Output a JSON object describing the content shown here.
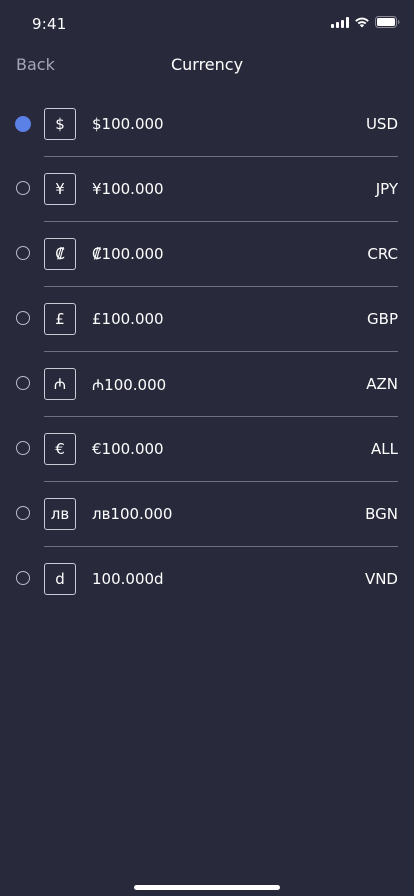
{
  "status_bar": {
    "time": "9:41"
  },
  "nav": {
    "back_label": "Back",
    "title": "Currency"
  },
  "currencies": [
    {
      "symbol": "$",
      "amount": "$100.000",
      "code": "USD",
      "selected": true
    },
    {
      "symbol": "¥",
      "amount": "¥100.000",
      "code": "JPY",
      "selected": false
    },
    {
      "symbol": "₡",
      "amount": "₡100.000",
      "code": "CRC",
      "selected": false
    },
    {
      "symbol": "£",
      "amount": "£100.000",
      "code": "GBP",
      "selected": false
    },
    {
      "symbol": "₼",
      "amount": "₼100.000",
      "code": "AZN",
      "selected": false
    },
    {
      "symbol": "€",
      "amount": "€100.000",
      "code": "ALL",
      "selected": false
    },
    {
      "symbol": "лв",
      "amount": "лв100.000",
      "code": "BGN",
      "selected": false
    },
    {
      "symbol": "d",
      "amount": "100.000d",
      "code": "VND",
      "selected": false
    }
  ],
  "colors": {
    "background": "#282a3c",
    "accent": "#5b80e6",
    "divider": "#6e7083",
    "muted_text": "#a3a6b5"
  }
}
